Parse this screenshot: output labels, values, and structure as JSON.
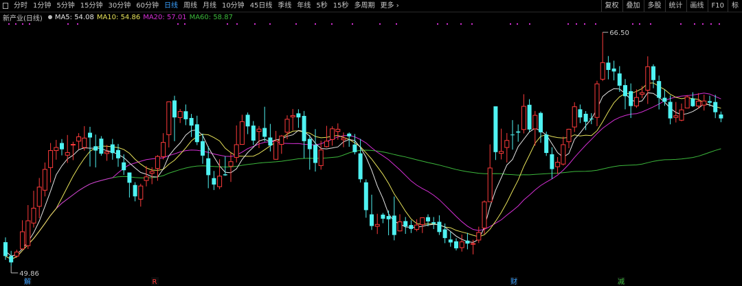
{
  "toolbar": {
    "tabs": [
      "分时",
      "1分钟",
      "5分钟",
      "15分钟",
      "30分钟",
      "60分钟",
      "日线",
      "周线",
      "月线",
      "10分钟",
      "45日线",
      "季线",
      "年线",
      "5秒",
      "15秒",
      "多周期",
      "更多 ›"
    ],
    "active": "日线",
    "right": [
      "复权",
      "叠加",
      "多股",
      "统计",
      "画线",
      "F10",
      "标"
    ]
  },
  "legend": {
    "title": "新产业(日线)",
    "ma5": "MA5: 54.08",
    "ma10": "MA10: 54.86",
    "ma20": "MA20: 57.01",
    "ma60": "MA60: 58.87"
  },
  "colors": {
    "up": "#ff3b3b",
    "down": "#4ff2f2",
    "ma5": "#e6e6e6",
    "ma10": "#e8e35a",
    "ma20": "#d52fd5",
    "ma60": "#3cb83c",
    "active_tab": "#3aa0ff"
  },
  "chart_data": {
    "type": "candlestick",
    "price_range": [
      49.86,
      66.5
    ],
    "annotations": {
      "high": "66.50",
      "low": "49.86"
    },
    "bottom_markers": [
      {
        "label": "解",
        "color": "#3aa0ff"
      },
      {
        "label": "R",
        "color": "#ff3b3b"
      },
      {
        "label": "财",
        "color": "#3aa0ff"
      },
      {
        "label": "减",
        "color": "#3cb83c"
      }
    ],
    "candles": [
      [
        51.56,
        50.57,
        51.9,
        50.3
      ],
      [
        50.57,
        50.12,
        50.94,
        49.86
      ],
      [
        50.57,
        50.86,
        51.02,
        50.46
      ],
      [
        51.08,
        52.3,
        53.12,
        51.76
      ],
      [
        51.31,
        53.08,
        54.2,
        51.08
      ],
      [
        52.92,
        53.98,
        55.22,
        52.6
      ],
      [
        54.11,
        55.48,
        56.13,
        53.27
      ],
      [
        55.26,
        56.74,
        57.23,
        54.82
      ],
      [
        56.87,
        58.08,
        58.62,
        55.81
      ],
      [
        58.08,
        58.3,
        58.84,
        57.43
      ],
      [
        58.62,
        58.17,
        58.9,
        57.74
      ],
      [
        57.75,
        57.94,
        59.19,
        57.2
      ],
      [
        58.52,
        58.52,
        58.71,
        57.4
      ],
      [
        58.75,
        59.06,
        59.32,
        58.17
      ],
      [
        58.3,
        58.97,
        59.82,
        58.08
      ],
      [
        59.35,
        59.01,
        59.77,
        56.95
      ],
      [
        58.39,
        58.08,
        59.22,
        56.88
      ],
      [
        58.93,
        57.86,
        59.11,
        57.72
      ],
      [
        57.87,
        57.99,
        58.48,
        57.35
      ],
      [
        58.52,
        57.9,
        58.91,
        57.43
      ],
      [
        58.12,
        57.53,
        58.55,
        56.92
      ],
      [
        57.24,
        56.68,
        57.81,
        56.35
      ],
      [
        56.52,
        55.79,
        56.52,
        54.74
      ],
      [
        55.63,
        54.82,
        55.83,
        54.47
      ],
      [
        54.62,
        55.56,
        55.72,
        54.09
      ],
      [
        55.95,
        56.21,
        56.98,
        55.53
      ],
      [
        56.46,
        56.59,
        56.89,
        55.69
      ],
      [
        56.81,
        57.66,
        57.76,
        55.93
      ],
      [
        57.65,
        58.66,
        59.32,
        57.45
      ],
      [
        59.21,
        61.55,
        61.55,
        58.3
      ],
      [
        61.65,
        60.44,
        61.98,
        58.75
      ],
      [
        60.43,
        60.86,
        61.04,
        60.04
      ],
      [
        60.88,
        60.31,
        61.36,
        59.89
      ],
      [
        60.4,
        59.86,
        60.69,
        59.05
      ],
      [
        59.95,
        58.68,
        60.56,
        58.47
      ],
      [
        58.75,
        57.72,
        59.29,
        57.14
      ],
      [
        57.53,
        56.33,
        58.39,
        55.4
      ],
      [
        56.12,
        55.66,
        56.63,
        55.27
      ],
      [
        55.51,
        56.26,
        57.46,
        55.33
      ],
      [
        56.39,
        56.32,
        57.68,
        56.28
      ],
      [
        56.97,
        57.29,
        57.91,
        55.85
      ],
      [
        57.59,
        58.5,
        59.87,
        57.24
      ],
      [
        58.52,
        60.14,
        60.63,
        58.49
      ],
      [
        60.63,
        59.8,
        60.79,
        59.25
      ],
      [
        59.86,
        58.79,
        60.18,
        58.48
      ],
      [
        59.44,
        59.61,
        59.83,
        58.26
      ],
      [
        59.69,
        59.06,
        61.2,
        58.72
      ],
      [
        59.01,
        58.44,
        59.98,
        58.02
      ],
      [
        57.46,
        58.76,
        59.48,
        57.43
      ],
      [
        58.52,
        59.12,
        59.19,
        57.85
      ],
      [
        59.39,
        60.31,
        60.59,
        58.89
      ],
      [
        60.48,
        60.57,
        61.04,
        59.53
      ],
      [
        60.73,
        60.44,
        61.02,
        59.7
      ],
      [
        60.55,
        58.75,
        60.9,
        57.53
      ],
      [
        58.91,
        58.18,
        59.19,
        56.72
      ],
      [
        58.48,
        57.2,
        59.61,
        56.59
      ],
      [
        57.01,
        58.12,
        58.78,
        56.72
      ],
      [
        58.36,
        58.75,
        59.84,
        58.3
      ],
      [
        58.87,
        59.63,
        59.81,
        58.43
      ],
      [
        59.44,
        59.6,
        60.02,
        58.85
      ],
      [
        58.85,
        58.97,
        59.37,
        58.32
      ],
      [
        59.29,
        59.09,
        59.37,
        58.35
      ],
      [
        58.51,
        57.97,
        59.26,
        57.81
      ],
      [
        57.88,
        56.04,
        58.91,
        55.81
      ],
      [
        55.82,
        53.84,
        56.03,
        53.3
      ],
      [
        53.54,
        52.71,
        54.94,
        52.43
      ],
      [
        52.69,
        52.82,
        53.58,
        52.14
      ],
      [
        53.52,
        53.23,
        53.64,
        52.91
      ],
      [
        53.42,
        53.19,
        53.82,
        52.05
      ],
      [
        53.45,
        52.07,
        54.81,
        51.69
      ],
      [
        52.36,
        53.01,
        53.55,
        52.33
      ],
      [
        53.06,
        52.68,
        53.35,
        52.15
      ],
      [
        52.78,
        52.5,
        53.12,
        52.21
      ],
      [
        52.47,
        52.78,
        53.19,
        52.33
      ],
      [
        52.81,
        53.3,
        53.32,
        52.21
      ],
      [
        53.34,
        53.04,
        53.54,
        52.69
      ],
      [
        52.98,
        52.88,
        53.35,
        52.49
      ],
      [
        53.01,
        52.28,
        53.47,
        52.07
      ],
      [
        52.47,
        51.85,
        52.89,
        51.49
      ],
      [
        51.75,
        51.54,
        52.29,
        51.24
      ],
      [
        51.62,
        51.12,
        51.84,
        50.97
      ],
      [
        51.17,
        51.58,
        52.1,
        50.89
      ],
      [
        51.67,
        51.46,
        52.22,
        51.05
      ],
      [
        51.41,
        51.46,
        51.73,
        50.69
      ],
      [
        51.71,
        52.25,
        52.66,
        51.5
      ],
      [
        52.57,
        54.43,
        54.53,
        52.14
      ],
      [
        54.44,
        56.84,
        58.52,
        54.44
      ],
      [
        61.23,
        57.97,
        61.23,
        57.41
      ],
      [
        57.88,
        58.02,
        59.64,
        57.45
      ],
      [
        58.3,
        58.8,
        59.33,
        57.23
      ],
      [
        59.22,
        59.19,
        60.25,
        58.15
      ],
      [
        59.44,
        59.36,
        59.94,
        58.71
      ],
      [
        59.58,
        61.23,
        62.09,
        59.3
      ],
      [
        61.34,
        59.58,
        61.74,
        59.42
      ],
      [
        59.63,
        60.59,
        60.9,
        58.43
      ],
      [
        60.76,
        59.38,
        60.86,
        58.63
      ],
      [
        59.22,
        57.91,
        59.43,
        57.7
      ],
      [
        57.82,
        56.76,
        58.32,
        56.07
      ],
      [
        56.93,
        57.25,
        57.62,
        56.42
      ],
      [
        57.12,
        58.5,
        59.07,
        57.02
      ],
      [
        58.71,
        59.6,
        59.63,
        58.25
      ],
      [
        59.76,
        61.2,
        61.52,
        59.4
      ],
      [
        61.02,
        60.44,
        61.36,
        60.04
      ],
      [
        60.7,
        60.13,
        60.89,
        59.54
      ],
      [
        60.36,
        60.3,
        60.74,
        59.96
      ],
      [
        60.44,
        62.83,
        63.05,
        59.82
      ],
      [
        63.16,
        64.34,
        66.5,
        63.03
      ],
      [
        64.34,
        63.82,
        64.81,
        63.15
      ],
      [
        63.92,
        63.71,
        64.48,
        63.08
      ],
      [
        63.57,
        62.7,
        64.09,
        62.26
      ],
      [
        62.74,
        61.95,
        63.17,
        61.02
      ],
      [
        62.31,
        61.25,
        62.86,
        60.4
      ],
      [
        61.26,
        61.86,
        62.44,
        61.12
      ],
      [
        62.09,
        62.2,
        62.68,
        61.81
      ],
      [
        62.38,
        64.05,
        64.79,
        61.4
      ],
      [
        64.08,
        63.1,
        64.22,
        62.52
      ],
      [
        63.03,
        61.84,
        63.42,
        61.01
      ],
      [
        61.84,
        61.55,
        62.44,
        61.27
      ],
      [
        61.55,
        60.37,
        62.01,
        59.95
      ],
      [
        60.44,
        60.56,
        61.54,
        60.08
      ],
      [
        60.24,
        60.98,
        61.43,
        60.17
      ],
      [
        61.11,
        61.9,
        62.03,
        61.6
      ],
      [
        61.79,
        61.24,
        62.23,
        61.19
      ],
      [
        61.25,
        61.6,
        62.17,
        61.06
      ],
      [
        61.32,
        61.61,
        62.06,
        60.93
      ],
      [
        61.6,
        61.49,
        61.99,
        61.22
      ],
      [
        61.54,
        60.81,
        62.05,
        60.39
      ],
      [
        60.65,
        60.37,
        60.86,
        60.1
      ]
    ],
    "ma5": [
      50.93,
      50.57,
      50.68,
      51.09,
      51.59,
      52.23,
      53.06,
      54.11,
      55.19,
      56.36,
      56.99,
      57.49,
      57.75,
      58.14,
      58.28,
      58.25,
      58.26,
      58.22,
      58.07,
      57.99,
      57.8,
      57.58,
      57.2,
      56.84,
      56.52,
      56.4,
      56.22,
      56.2,
      56.77,
      57.7,
      58.2,
      58.62,
      59.18,
      59.51,
      59.54,
      59.16,
      58.31,
      57.63,
      56.99,
      56.54,
      56.5,
      56.78,
      57.45,
      57.94,
      58.32,
      58.76,
      58.89,
      58.71,
      58.85,
      58.91,
      59.1,
      59.2,
      59.52,
      59.44,
      59.11,
      58.6,
      58.23,
      58.2,
      58.27,
      58.34,
      58.7,
      58.87,
      58.79,
      58.3,
      57.62,
      56.68,
      55.56,
      54.67,
      53.57,
      53.04,
      52.86,
      52.64,
      52.62,
      52.62,
      52.69,
      52.78,
      52.83,
      52.8,
      52.64,
      52.32,
      51.99,
      51.76,
      51.6,
      51.54,
      51.76,
      52.61,
      54.09,
      55.26,
      56.15,
      57.05,
      57.45,
      58.36,
      58.89,
      59.41,
      59.67,
      59.48,
      59.2,
      58.57,
      57.93,
      57.61,
      57.87,
      58.89,
      59.33,
      59.85,
      60.33,
      61.05,
      61.93,
      62.26,
      62.49,
      62.46,
      62.14,
      61.71,
      61.52,
      61.62,
      62.2,
      62.15,
      61.87,
      61.53,
      61.1,
      60.79,
      60.64,
      60.71,
      60.86,
      61.1,
      61.41,
      61.33,
      61.16
    ]
  }
}
